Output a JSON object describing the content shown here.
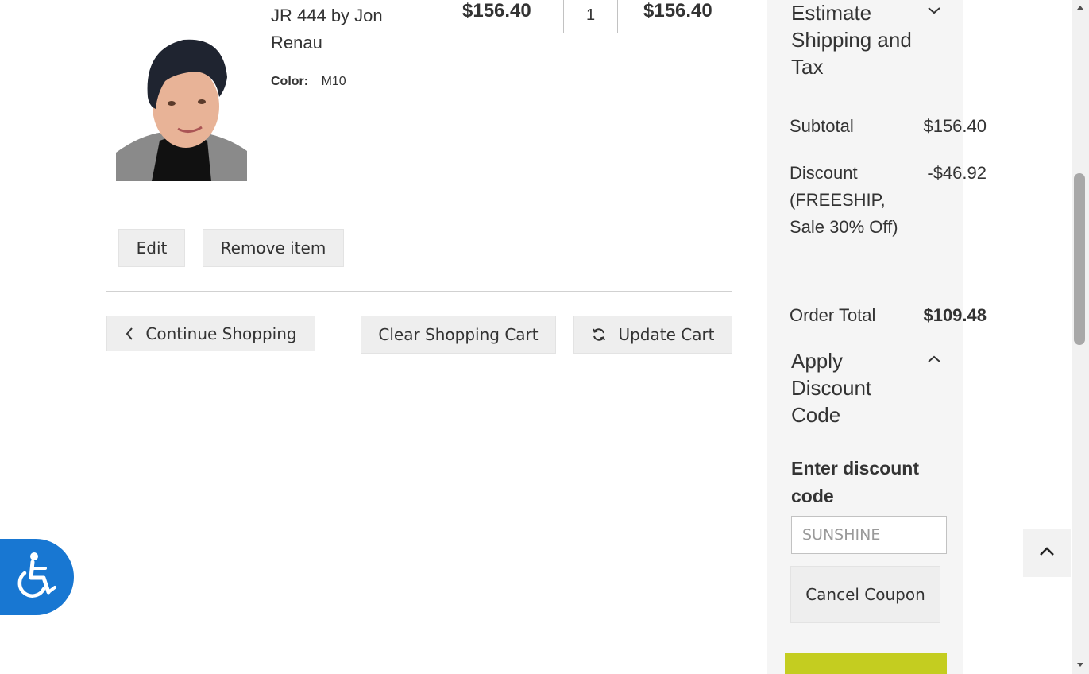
{
  "item": {
    "name": "JR 444 by Jon Renau",
    "option_label": "Color:",
    "option_value": "M10",
    "price": "$156.40",
    "qty": "1",
    "subtotal": "$156.40",
    "edit_label": "Edit",
    "remove_label": "Remove item"
  },
  "actions": {
    "continue_label": "Continue Shopping",
    "clear_label": "Clear Shopping Cart",
    "update_label": "Update Cart"
  },
  "summary": {
    "estimate_heading": "Estimate Shipping and Tax",
    "subtotal_label": "Subtotal",
    "subtotal_value": "$156.40",
    "discount_label": "Discount (FREESHIP, Sale 30% Off)",
    "discount_value": "-$46.92",
    "order_total_label": "Order Total",
    "order_total_value": "$109.48",
    "discount_heading": "Apply Discount Code",
    "enter_code_label": "Enter discount code",
    "code_value": "SUNSHINE",
    "cancel_label": "Cancel Coupon"
  },
  "colors": {
    "accessibility_blue": "#1877d2",
    "checkout_green": "#c4cd20"
  }
}
